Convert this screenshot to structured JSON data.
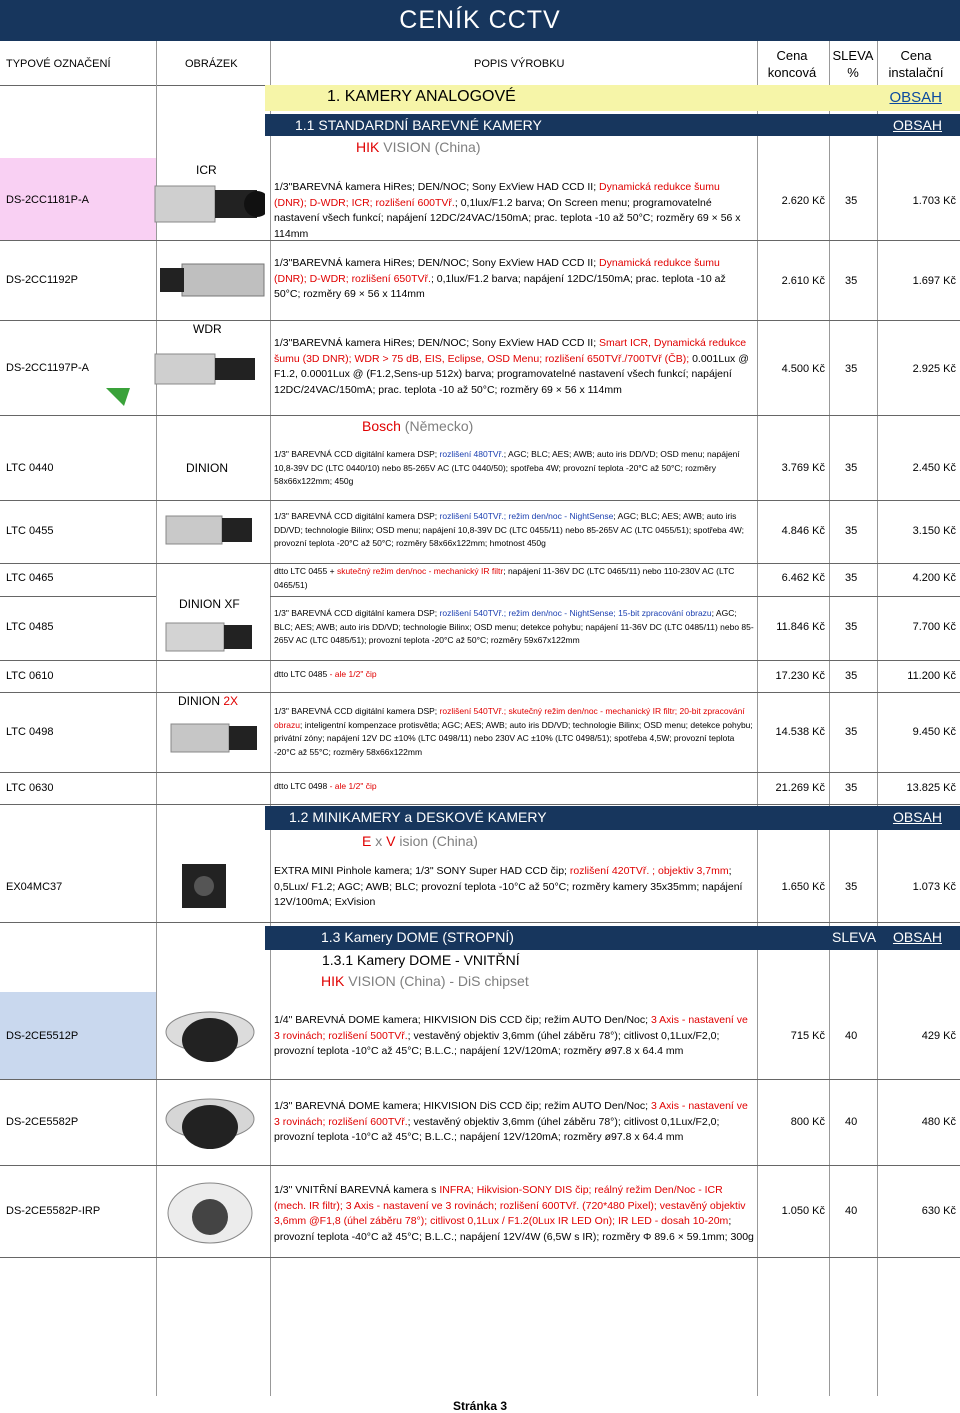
{
  "title": "CENÍK CCTV",
  "header": {
    "col_type": "TYPOVÉ OZNAČENÍ",
    "col_image": "OBRÁZEK",
    "col_desc": "POPIS VÝROBKU",
    "col_price_1": "Cena",
    "col_price_2": "koncová",
    "col_sleva_1": "SLEVA",
    "col_sleva_2": "%",
    "col_inst_1": "Cena",
    "col_inst_2": "instalační"
  },
  "obsah": "OBSAH",
  "sleva_label": "SLEVA",
  "sections": {
    "s1": "1.  KAMERY ANALOGOVÉ",
    "s11": "1.1  STANDARDNÍ BAREVNÉ KAMERY",
    "s12": "1.2  MINIKAMERY a DESKOVÉ KAMERY",
    "s13": "1.3  Kamery DOME (STROPNÍ)",
    "s131": "1.3.1  Kamery DOME - VNITŘNÍ"
  },
  "brands": {
    "hik1": {
      "a": "HIK",
      "b": " VISION (China)"
    },
    "bosch": {
      "a": "Bosch",
      "b": " (Německo)"
    },
    "exvision": {
      "a": "E",
      "b": " x ",
      "c": "V",
      "d": " ision  (China)"
    },
    "hik2": {
      "a": "HIK",
      "b": " VISION (China) - DiS chipset"
    }
  },
  "image_labels": {
    "icr": "ICR",
    "wdr": "WDR",
    "dinion": "DINION",
    "dinion_xf": "DINION XF",
    "dinion_2x_a": "DINION ",
    "dinion_2x_b": "2X"
  },
  "products": [
    {
      "code": "DS-2CC1181P-A",
      "desc_1": "1/3\"BAREVNÁ kamera HiRes; DEN/NOC; Sony ExView HAD CCD II; ",
      "desc_2": "Dynamická redukce šumu (DNR); D-WDR; ICR; rozlišení 600TVř.",
      "desc_3": "; 0,1lux/F1.2 barva; On Screen menu; programovatelné nastavení všech funkcí; napájení 12DC/24VAC/150mA; prac. teplota -10 až 50°C; rozměry 69 × 56 x 114mm",
      "price": "2.620 Kč",
      "sleva": "35",
      "inst": "1.703 Kč"
    },
    {
      "code": "DS-2CC1192P",
      "desc_1": "1/3\"BAREVNÁ kamera HiRes; DEN/NOC; Sony ExView HAD CCD II; ",
      "desc_2": "Dynamická redukce šumu (DNR); D-WDR; rozlišení 650TVř.",
      "desc_3": "; 0,1lux/F1.2 barva; napájení 12DC/150mA; prac. teplota -10 až 50°C; rozměry 69 × 56 x 114mm",
      "price": "2.610 Kč",
      "sleva": "35",
      "inst": "1.697 Kč"
    },
    {
      "code": "DS-2CC1197P-A",
      "desc_1": "1/3\"BAREVNÁ kamera HiRes; DEN/NOC; Sony ExView HAD CCD II; ",
      "desc_2": "Smart ICR, Dynamická redukce šumu (3D DNR); WDR > 75 dB, EIS, Eclipse, OSD Menu; rozlišení 650TVř./700TVř (ČB);",
      "desc_3": " 0.001Lux @ F1.2, 0.0001Lux @ (F1.2,Sens-up 512x) barva; programovatelné nastavení všech funkcí; napájení 12DC/24VAC/150mA; prac. teplota -10 až 50°C; rozměry 69 × 56 x 114mm",
      "price": "4.500 Kč",
      "sleva": "35",
      "inst": "2.925 Kč"
    },
    {
      "code": "LTC 0440",
      "desc_1": "1/3\" BAREVNÁ CCD digitální kamera DSP; ",
      "desc_2": "rozlišení 480TVř.",
      "desc_3": "; AGC; BLC; AES; AWB; auto iris DD/VD; OSD menu; napájení 10,8-39V DC (LTC 0440/10) nebo 85-265V AC (LTC 0440/50); spotřeba 4W; provozní teplota -20°C až 50°C; rozměry 58x66x122mm; 450g",
      "price": "3.769 Kč",
      "sleva": "35",
      "inst": "2.450 Kč"
    },
    {
      "code": "LTC 0455",
      "desc_1": "1/3\" BAREVNÁ CCD digitální kamera DSP; ",
      "desc_2": "rozlišení 540TVř.; režim den/noc - NightSense",
      "desc_3": "; AGC; BLC; AES; AWB; auto iris DD/VD; technologie Bilinx; OSD menu; napájení 10,8-39V DC (LTC 0455/11) nebo 85-265V AC (LTC 0455/51); spotřeba 4W; provozní teplota -20°C až 50°C; rozměry 58x66x122mm; hmotnost 450g",
      "price": "4.846 Kč",
      "sleva": "35",
      "inst": "3.150 Kč"
    },
    {
      "code": "LTC 0465",
      "desc_1": "dtto LTC 0455 + ",
      "desc_2": "skutečný režim den/noc - mechanický IR filtr",
      "desc_3": "; napájení 11-36V DC (LTC 0465/11) nebo 110-230V AC (LTC 0465/51)",
      "price": "6.462 Kč",
      "sleva": "35",
      "inst": "4.200 Kč"
    },
    {
      "code": "LTC 0485",
      "desc_1": "1/3\" BAREVNÁ CCD digitální kamera DSP; ",
      "desc_2": "rozlišení 540TVř.; režim den/noc - NightSense; 15-bit zpracování obrazu",
      "desc_3": "; AGC; BLC; AES; AWB; auto iris DD/VD; technologie Bilinx; OSD menu; detekce pohybu; napájení 11-36V DC (LTC 0485/11) nebo 85-265V AC (LTC 0485/51); provozní teplota -20°C až 50°C; rozměry 59x67x122mm",
      "price": "11.846 Kč",
      "sleva": "35",
      "inst": "7.700 Kč"
    },
    {
      "code": "LTC 0610",
      "desc_1": "dtto LTC 0485 ",
      "desc_2": "- ale 1/2\" čip",
      "desc_3": "",
      "price": "17.230 Kč",
      "sleva": "35",
      "inst": "11.200 Kč"
    },
    {
      "code": "LTC 0498",
      "desc_1": "1/3\" BAREVNÁ CCD digitální kamera DSP; ",
      "desc_2": "rozlišení 540TVř.;  skutečný režim den/noc - mechanický IR filtr; 20-bit zpracování obrazu",
      "desc_3": "; inteligentní kompenzace protisvětla; AGC; AES; AWB; auto iris DD/VD; technologie Bilinx; OSD menu; detekce pohybu; privátní zóny; napájení 12V DC ±10% (LTC 0498/11) nebo 230V AC ±10% (LTC 0498/51); spotřeba 4,5W; provozní teplota -20°C až 55°C; rozměry 58x66x122mm",
      "price": "14.538 Kč",
      "sleva": "35",
      "inst": "9.450 Kč"
    },
    {
      "code": "LTC 0630",
      "desc_1": "dtto LTC 0498 ",
      "desc_2": "- ale 1/2\" čip",
      "desc_3": "",
      "price": "21.269 Kč",
      "sleva": "35",
      "inst": "13.825 Kč"
    },
    {
      "code": "EX04MC37",
      "desc_1": "EXTRA MINI Pinhole kamera; 1/3\" SONY Super HAD CCD čip; ",
      "desc_2": "rozlišení 420TVř. ; objektiv 3,7mm",
      "desc_3": "; 0,5Lux/ F1.2; AGC; AWB; BLC; provozní teplota -10°C až 50°C; rozměry kamery 35x35mm; napájení 12V/100mA; ExVision",
      "price": "1.650 Kč",
      "sleva": "35",
      "inst": "1.073 Kč"
    },
    {
      "code": "DS-2CE5512P",
      "desc_1": "1/4\" BAREVNÁ DOME kamera; HIKVISION DiS CCD čip; režim AUTO Den/Noc; ",
      "desc_2": "3 Axis - nastavení ve 3 rovinách; rozlišení 500TVř.",
      "desc_3": "; vestavěný objektiv 3,6mm (úhel záběru 78°); citlivost 0,1Lux/F2,0; provozní teplota -10°C až 45°C; B.L.C.; napájení 12V/120mA; rozměry ø97.8 x 64.4 mm",
      "price": "715 Kč",
      "sleva": "40",
      "inst": "429 Kč"
    },
    {
      "code": "DS-2CE5582P",
      "desc_1": "1/3\" BAREVNÁ DOME kamera; HIKVISION DiS CCD čip; režim AUTO Den/Noc; ",
      "desc_2": "3 Axis - nastavení ve 3 rovinách; rozlišení 600TVř.",
      "desc_3": "; vestavěný objektiv 3,6mm (úhel záběru 78°); citlivost 0,1Lux/F2,0; provozní teplota -10°C až 45°C; B.L.C.; napájení 12V/120mA; rozměry ø97.8 x 64.4 mm",
      "price": "800 Kč",
      "sleva": "40",
      "inst": "480 Kč"
    },
    {
      "code": "DS-2CE5582P-IRP",
      "desc_1": "1/3\" VNITŘNÍ BAREVNÁ kamera s ",
      "desc_2": "INFRA; Hikvision-SONY DIS čip; reálný režim Den/Noc - ICR (mech. IR filtr); 3 Axis - nastavení ve 3 rovinách; rozlišení 600TVř. (720*480 Pixel); vestavěný objektiv 3,6mm @F1,8 (úhel záběru 78°); citlivost 0,1Lux / F1.2(0Lux IR LED On); IR LED - dosah 10-20m",
      "desc_3": "; provozní teplota -40°C až 45°C; B.L.C.; napájení 12V/4W (6,5W s IR); rozměry Φ 89.6 × 59.1mm; 300g",
      "price": "1.050 Kč",
      "sleva": "40",
      "inst": "630 Kč"
    }
  ],
  "footer": "Stránka 3"
}
